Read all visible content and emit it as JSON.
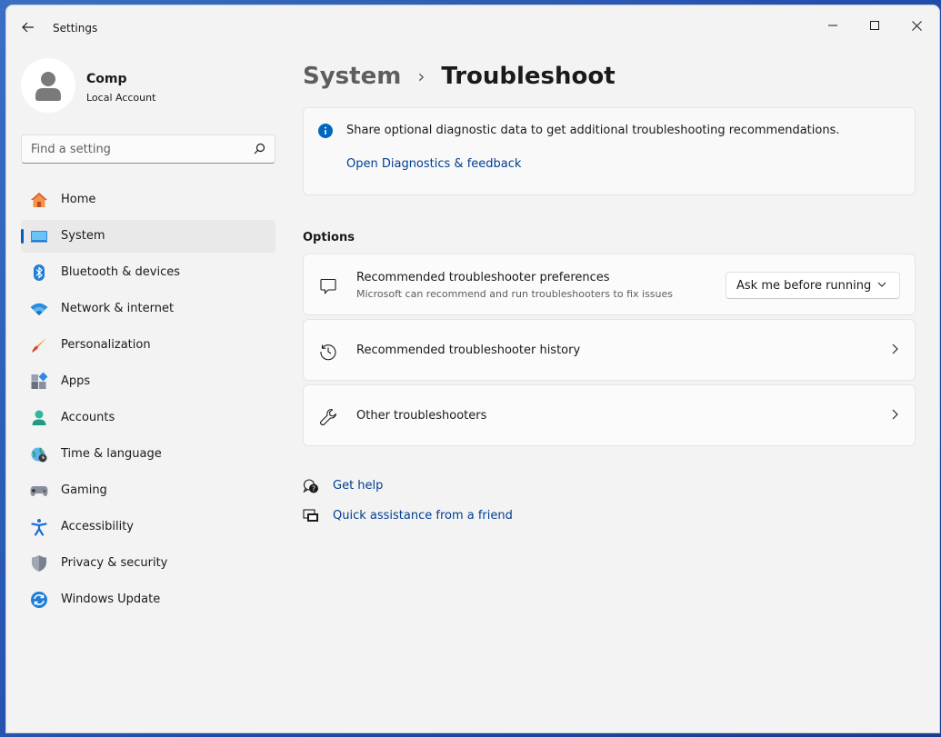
{
  "window": {
    "title": "Settings"
  },
  "profile": {
    "name": "Comp",
    "account_type": "Local Account"
  },
  "search": {
    "placeholder": "Find a setting"
  },
  "sidebar": {
    "items": [
      {
        "label": "Home",
        "icon": "home-icon"
      },
      {
        "label": "System",
        "icon": "system-icon",
        "active": true
      },
      {
        "label": "Bluetooth & devices",
        "icon": "bluetooth-icon"
      },
      {
        "label": "Network & internet",
        "icon": "wifi-icon"
      },
      {
        "label": "Personalization",
        "icon": "brush-icon"
      },
      {
        "label": "Apps",
        "icon": "apps-icon"
      },
      {
        "label": "Accounts",
        "icon": "accounts-icon"
      },
      {
        "label": "Time & language",
        "icon": "globe-clock-icon"
      },
      {
        "label": "Gaming",
        "icon": "gamepad-icon"
      },
      {
        "label": "Accessibility",
        "icon": "accessibility-icon"
      },
      {
        "label": "Privacy & security",
        "icon": "shield-icon"
      },
      {
        "label": "Windows Update",
        "icon": "update-icon"
      }
    ]
  },
  "breadcrumb": {
    "parent": "System",
    "separator": "›",
    "current": "Troubleshoot"
  },
  "info_banner": {
    "text": "Share optional diagnostic data to get additional troubleshooting recommendations.",
    "link": "Open Diagnostics & feedback"
  },
  "options": {
    "section_title": "Options",
    "preferences": {
      "title": "Recommended troubleshooter preferences",
      "subtitle": "Microsoft can recommend and run troubleshooters to fix issues",
      "dropdown_value": "Ask me before running"
    },
    "history": {
      "title": "Recommended troubleshooter history"
    },
    "other": {
      "title": "Other troubleshooters"
    }
  },
  "help": {
    "get_help": "Get help",
    "quick_assist": "Quick assistance from a friend"
  },
  "colors": {
    "accent": "#005fb8",
    "link": "#003e92",
    "window_bg": "#f3f3f3",
    "card_bg": "#fbfbfb"
  }
}
